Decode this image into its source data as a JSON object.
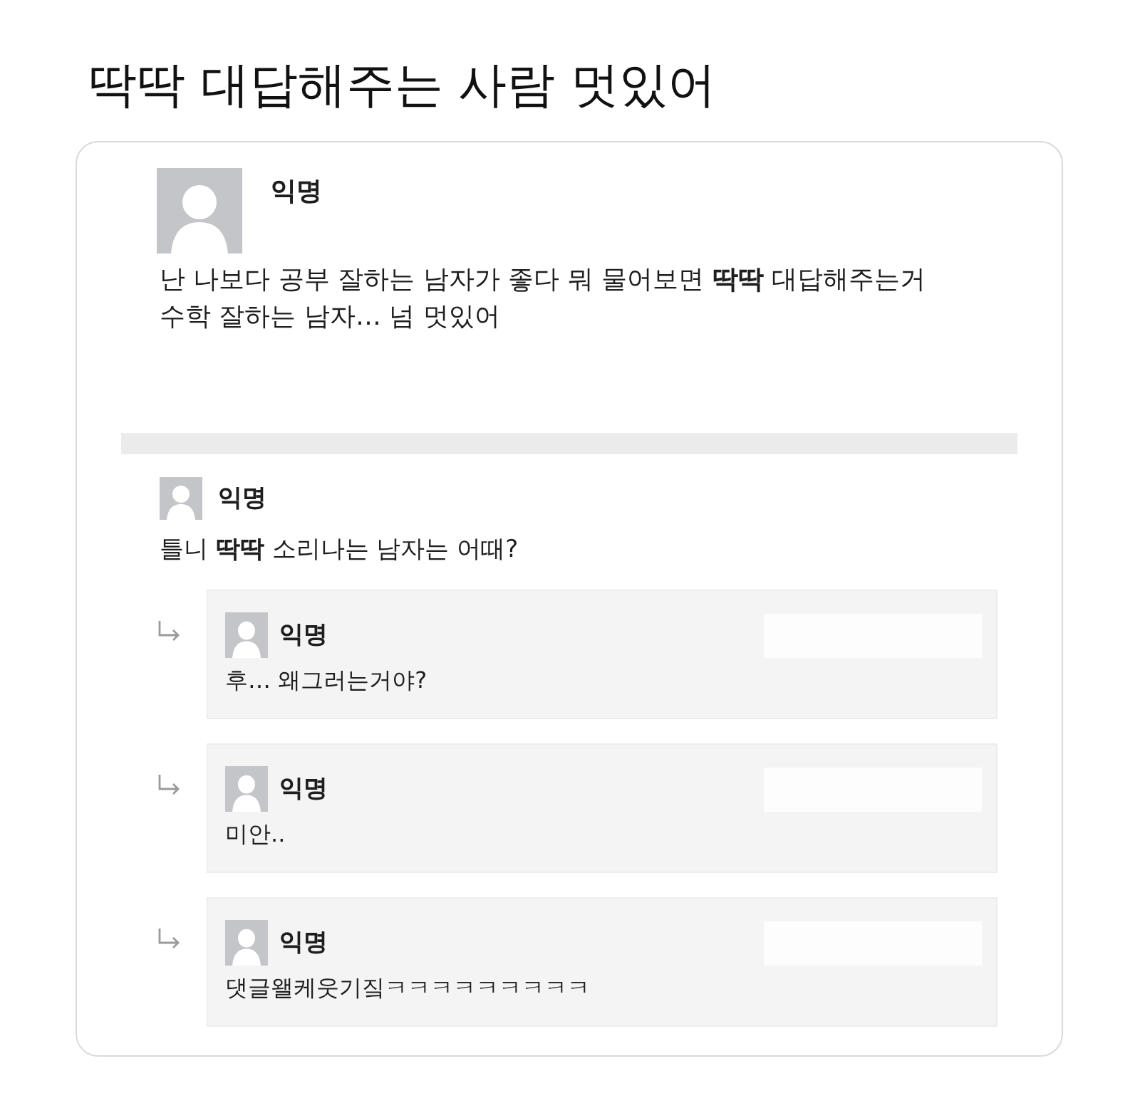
{
  "title": "딱딱 대답해주는 사람 멋있어",
  "post": {
    "author": "익명",
    "lines": [
      "난 나보다 공부 잘하는 남자가 좋다 뭐 물어보면 **딱딱** 대답해주는거",
      "수학 잘하는 남자… 넘 멋있어"
    ]
  },
  "comment": {
    "author": "익명",
    "text": "틀니 **딱딱** 소리나는 남자는 어때?",
    "replies": [
      {
        "author": "익명",
        "text": "후… 왜그러는거야?"
      },
      {
        "author": "익명",
        "text": "미안.."
      },
      {
        "author": "익명",
        "text": "댓글왤케웃기짘ㅋㅋㅋㅋㅋㅋㅋㅋㅋ"
      }
    ]
  }
}
